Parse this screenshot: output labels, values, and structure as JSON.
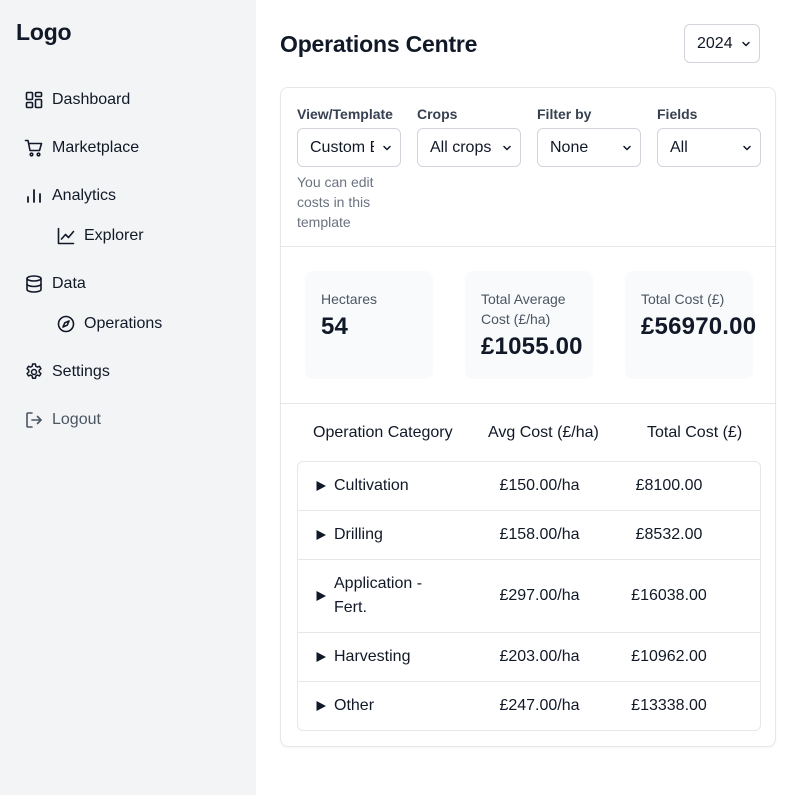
{
  "sidebar": {
    "logo": "Logo",
    "items": [
      {
        "label": "Dashboard",
        "icon": "dashboard-icon"
      },
      {
        "label": "Marketplace",
        "icon": "cart-icon"
      },
      {
        "label": "Analytics",
        "icon": "bar-chart-icon"
      },
      {
        "label": "Explorer",
        "icon": "line-chart-icon"
      },
      {
        "label": "Data",
        "icon": "database-icon"
      },
      {
        "label": "Operations",
        "icon": "compass-icon"
      },
      {
        "label": "Settings",
        "icon": "gear-icon"
      },
      {
        "label": "Logout",
        "icon": "logout-icon"
      }
    ]
  },
  "header": {
    "title": "Operations Centre",
    "year": "2024"
  },
  "filters": {
    "view_template": {
      "label": "View/Template",
      "value": "Custom Basic"
    },
    "crops": {
      "label": "Crops",
      "value": "All crops"
    },
    "filter_by": {
      "label": "Filter by",
      "value": "None"
    },
    "fields": {
      "label": "Fields",
      "value": "All"
    },
    "helper_text": "You can edit costs in this template"
  },
  "stats": {
    "hectares": {
      "label": "Hectares",
      "value": "54"
    },
    "avg_cost": {
      "label": "Total Average Cost (£/ha)",
      "value": "£1055.00"
    },
    "total_cost": {
      "label": "Total Cost (£)",
      "value": "£56970.00"
    }
  },
  "table": {
    "columns": [
      "Operation Category",
      "Avg Cost (£/ha)",
      "Total Cost (£)"
    ],
    "rows": [
      {
        "category": "Cultivation",
        "avg": "£150.00/ha",
        "total": "£8100.00"
      },
      {
        "category": "Drilling",
        "avg": "£158.00/ha",
        "total": "£8532.00"
      },
      {
        "category": "Application - Fert.",
        "avg": "£297.00/ha",
        "total": "£16038.00"
      },
      {
        "category": "Harvesting",
        "avg": "£203.00/ha",
        "total": "£10962.00"
      },
      {
        "category": "Other",
        "avg": "£247.00/ha",
        "total": "£13338.00"
      }
    ]
  },
  "colors": {
    "sidebar_bg": "#f3f4f6",
    "border": "#e5e7eb",
    "stat_bg": "#f9fafb",
    "muted_text": "#6b7280"
  }
}
